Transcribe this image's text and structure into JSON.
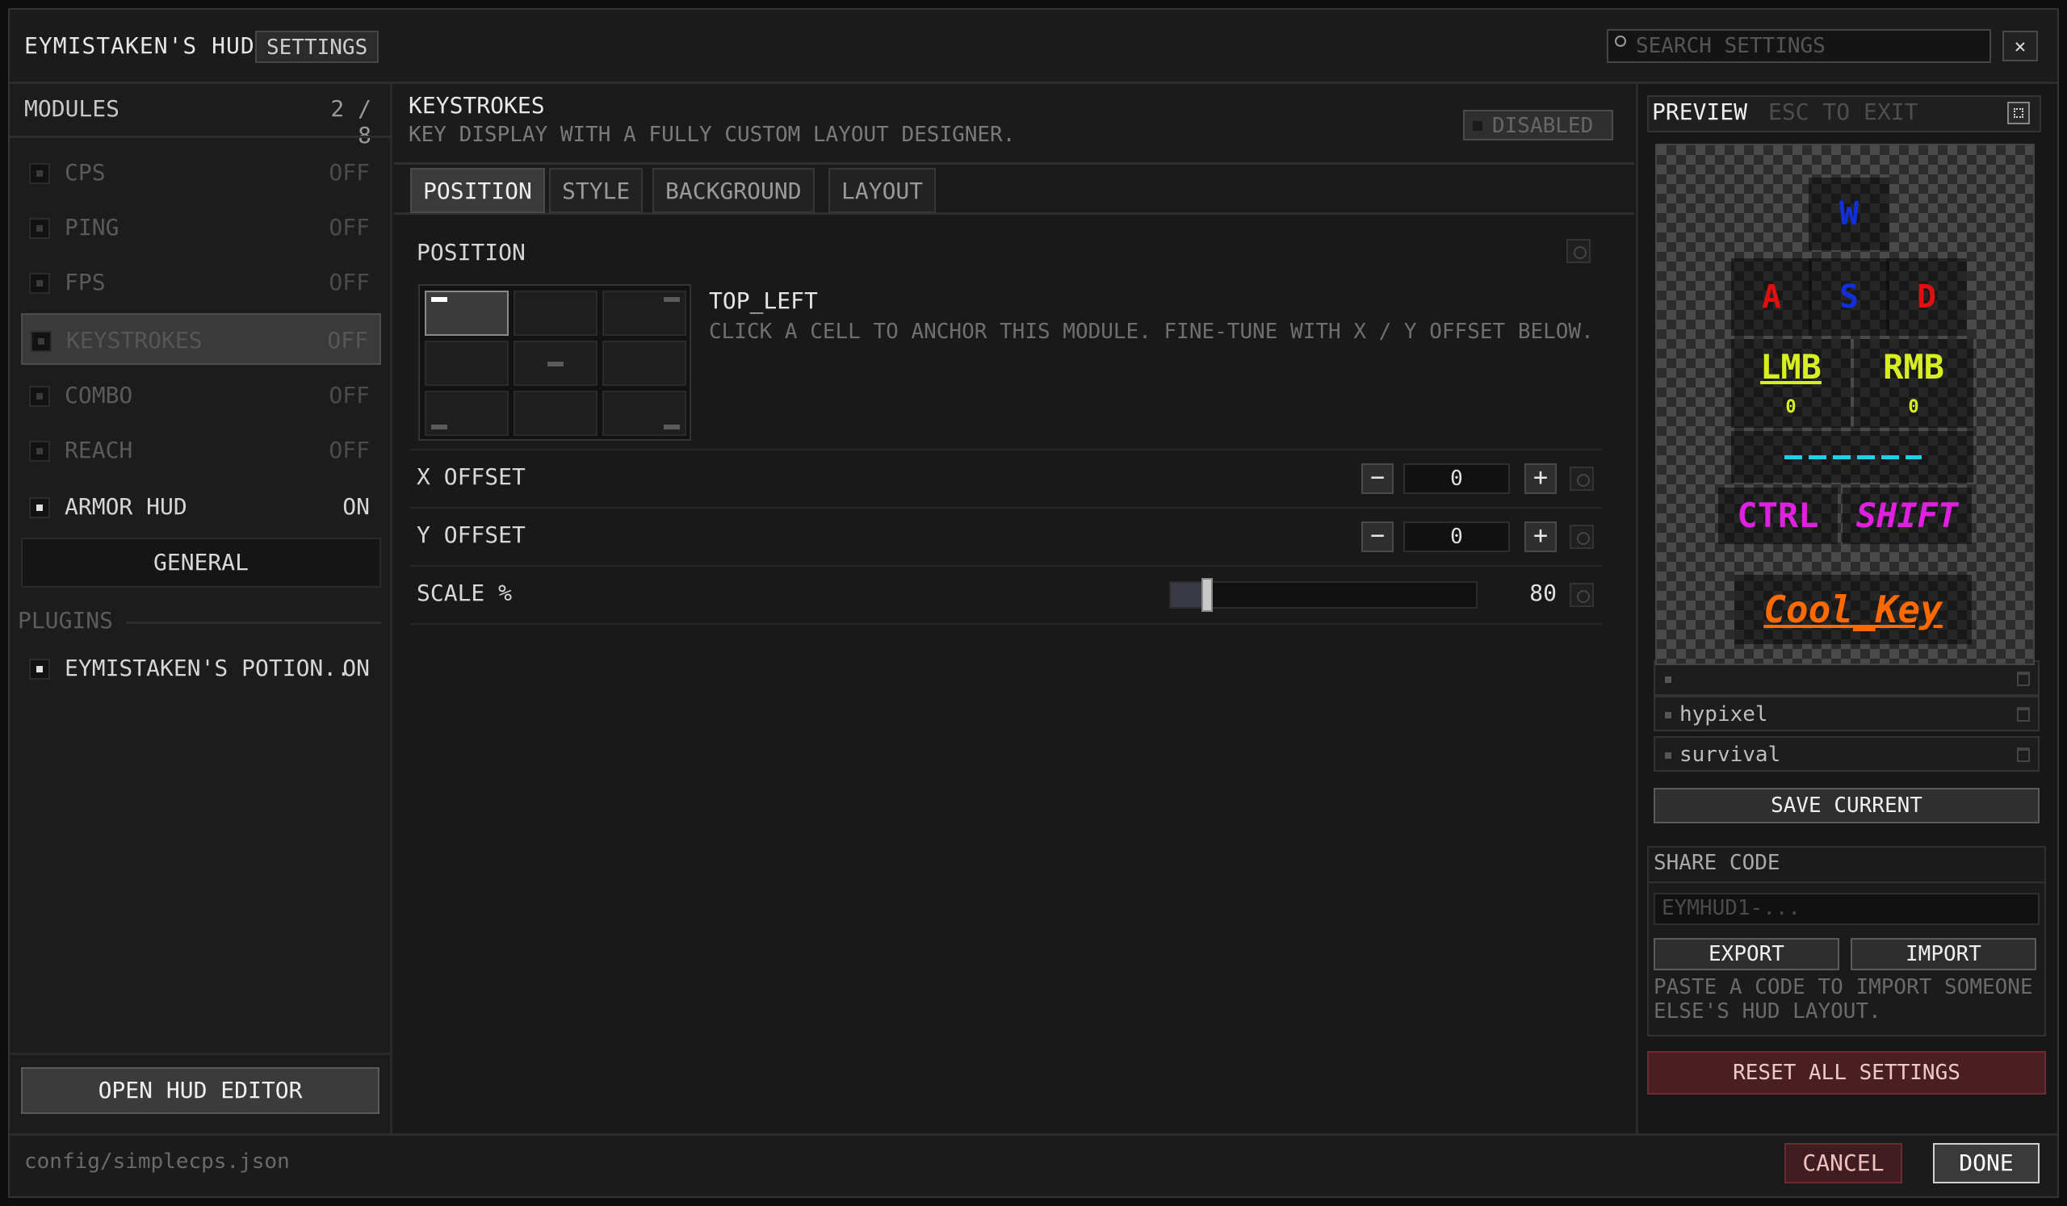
{
  "header": {
    "title": "EYMISTAKEN'S HUD",
    "tab": "SETTINGS",
    "search_placeholder": "SEARCH SETTINGS",
    "close": "✕"
  },
  "modules": {
    "heading": "MODULES",
    "count": "2 / 8",
    "items": [
      {
        "label": "CPS",
        "state": "OFF"
      },
      {
        "label": "PING",
        "state": "OFF"
      },
      {
        "label": "FPS",
        "state": "OFF"
      },
      {
        "label": "KEYSTROKES",
        "state": "OFF"
      },
      {
        "label": "COMBO",
        "state": "OFF"
      },
      {
        "label": "REACH",
        "state": "OFF"
      },
      {
        "label": "ARMOR HUD",
        "state": "ON"
      }
    ],
    "general": "GENERAL",
    "plugins_heading": "PLUGINS",
    "plugins": [
      {
        "label": "EYMISTAKEN'S POTION..",
        "state": "ON"
      }
    ],
    "open_editor": "OPEN HUD EDITOR"
  },
  "main": {
    "title": "KEYSTROKES",
    "subtitle": "KEY DISPLAY WITH A FULLY CUSTOM LAYOUT DESIGNER.",
    "status": "DISABLED",
    "tabs": [
      {
        "label": "POSITION"
      },
      {
        "label": "STYLE"
      },
      {
        "label": "BACKGROUND"
      },
      {
        "label": "LAYOUT"
      }
    ],
    "position": {
      "heading": "POSITION",
      "anchor": "TOP_LEFT",
      "description": "CLICK A CELL TO ANCHOR THIS MODULE. FINE-TUNE WITH X / Y OFFSET BELOW."
    },
    "x_offset": {
      "label": "X OFFSET",
      "value": "0"
    },
    "y_offset": {
      "label": "Y OFFSET",
      "value": "0"
    },
    "scale": {
      "label": "SCALE %",
      "value": "80",
      "fraction": 0.1
    }
  },
  "preview": {
    "title": "PREVIEW",
    "hint": "ESC TO EXIT",
    "keys": {
      "w": "W",
      "a": "A",
      "s": "S",
      "d": "D",
      "lmb": "LMB",
      "lmb_count": "0",
      "rmb": "RMB",
      "rmb_count": "0",
      "ctrl": "CTRL",
      "shift": "SHIFT",
      "custom": "Cool_Key"
    },
    "key_colors": {
      "wasd_blue": "#1030e0",
      "wasd_red": "#e01010",
      "mouse": "#d7ee20",
      "space": "#20d0e8",
      "modifiers": "#e020e0",
      "custom": "#ff6a00"
    }
  },
  "layouts": {
    "items": [
      {
        "name": "hypixel"
      },
      {
        "name": "survival"
      }
    ],
    "save": "SAVE CURRENT"
  },
  "share": {
    "title": "SHARE CODE",
    "placeholder": "EYMHUD1-...",
    "export": "EXPORT",
    "import": "IMPORT",
    "note": "PASTE A CODE TO IMPORT SOMEONE ELSE'S HUD LAYOUT."
  },
  "reset_all": "RESET ALL SETTINGS",
  "footer": {
    "path": "config/simplecps.json",
    "cancel": "CANCEL",
    "done": "DONE"
  }
}
